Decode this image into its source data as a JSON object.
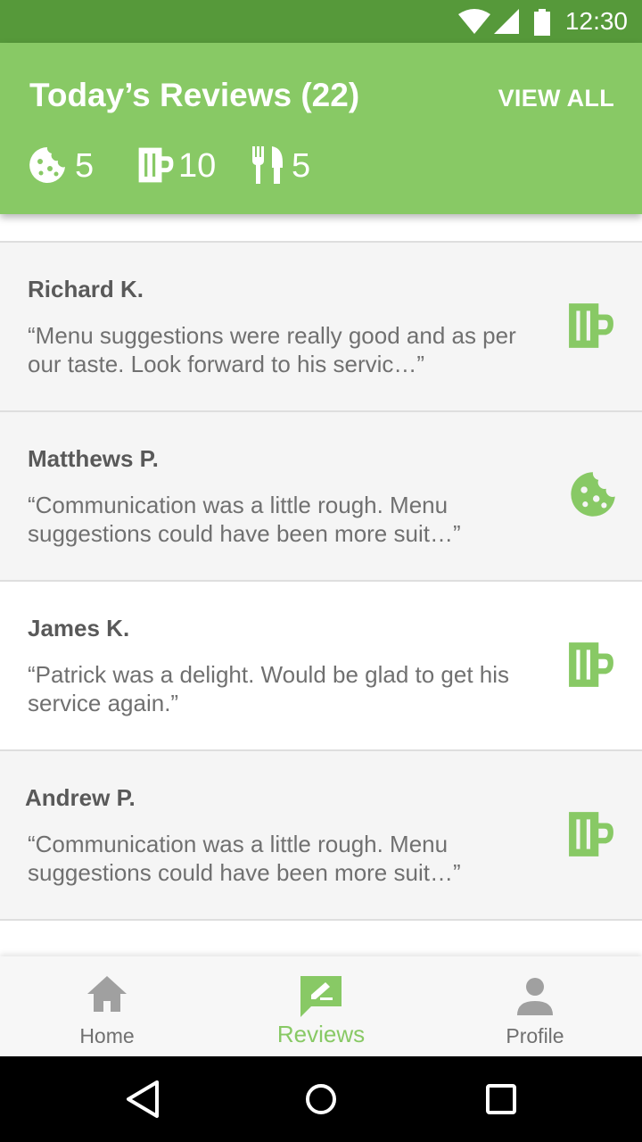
{
  "status_bar": {
    "time": "12:30",
    "icons": [
      "wifi-icon",
      "signal-icon",
      "battery-icon"
    ]
  },
  "header": {
    "title": "Today’s Reviews (22)",
    "view_all": "VIEW ALL",
    "stats": [
      {
        "icon": "cookie-icon",
        "value": "5"
      },
      {
        "icon": "beer-mug-icon",
        "value": "10"
      },
      {
        "icon": "cutlery-icon",
        "value": "5"
      }
    ]
  },
  "reviews": [
    {
      "name": "Richard K.",
      "text": "“Menu suggestions were really good and as per our taste. Look forward to his servic…”",
      "icon": "beer-mug-icon"
    },
    {
      "name": "Matthews P.",
      "text": "“Communication was a little rough. Menu suggestions could have been more suit…”",
      "icon": "cookie-icon"
    },
    {
      "name": "James K.",
      "text": "“Patrick was a delight. Would be glad to get his service again.”",
      "icon": "beer-mug-icon"
    },
    {
      "name": "Andrew P.",
      "text": "“Communication was a little rough. Menu suggestions could have been more suit…”",
      "icon": "beer-mug-icon"
    }
  ],
  "bottom_nav": {
    "items": [
      {
        "label": "Home",
        "icon": "home-icon",
        "active": false
      },
      {
        "label": "Reviews",
        "icon": "rate-review-icon",
        "active": true
      },
      {
        "label": "Profile",
        "icon": "person-icon",
        "active": false
      }
    ]
  },
  "colors": {
    "status_bar": "#56993a",
    "header": "#88c965",
    "accent": "#88c965",
    "review_bg_shaded": "#f5f5f5",
    "text_dark": "#595959",
    "text_muted": "#707070"
  }
}
